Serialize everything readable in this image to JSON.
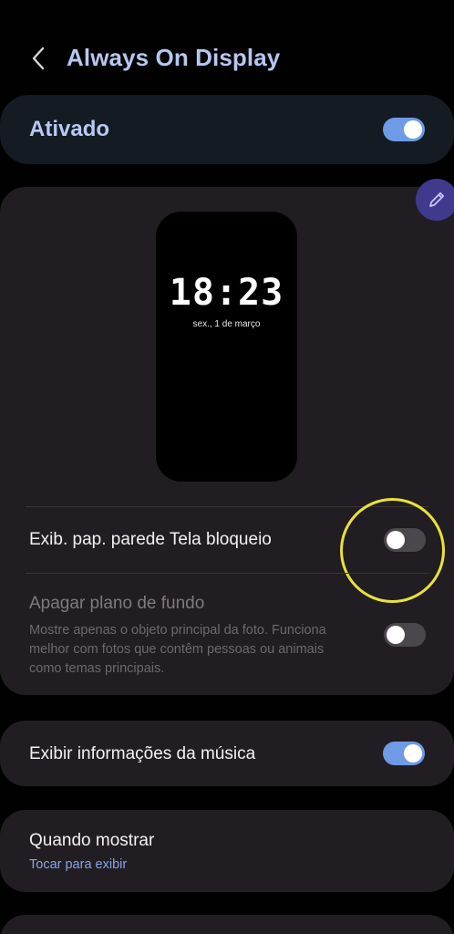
{
  "header": {
    "title": "Always On Display",
    "back_icon": "chevron-left-icon"
  },
  "main_toggle": {
    "label": "Ativado",
    "enabled": true
  },
  "preview": {
    "time": "18:23",
    "date": "sex., 1 de março",
    "edit_icon": "pencil-icon"
  },
  "settings": {
    "lock_wallpaper": {
      "label": "Exib. pap. parede Tela bloqueio",
      "enabled": false
    },
    "erase_background": {
      "label": "Apagar plano de fundo",
      "description": "Mostre apenas o objeto principal da foto. Funciona melhor com fotos que contêm pessoas ou animais como temas principais.",
      "enabled": false
    },
    "music_info": {
      "label": "Exibir informações da música",
      "enabled": true
    },
    "when_to_show": {
      "label": "Quando mostrar",
      "value": "Tocar para exibir"
    }
  },
  "colors": {
    "accent": "#6e9ae6",
    "title": "#b7c7ef",
    "highlight": "#e8e23a",
    "card": "#221d22"
  }
}
